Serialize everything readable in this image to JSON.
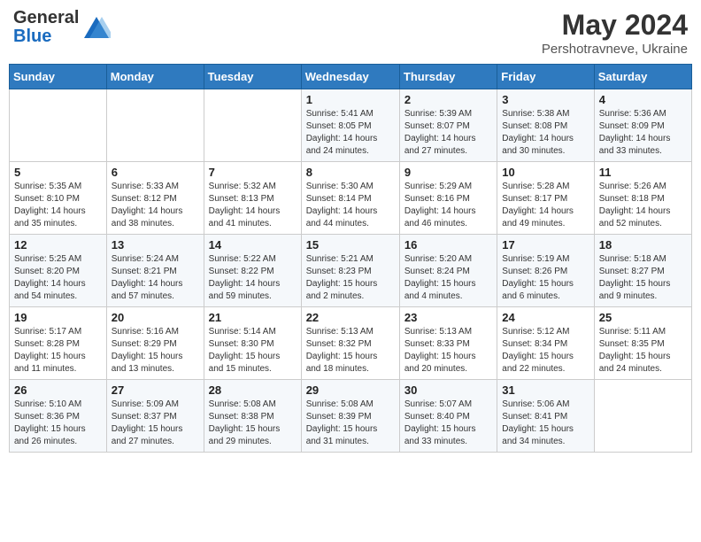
{
  "header": {
    "logo_line1": "General",
    "logo_line2": "Blue",
    "month_year": "May 2024",
    "location": "Pershotravneve, Ukraine"
  },
  "days_of_week": [
    "Sunday",
    "Monday",
    "Tuesday",
    "Wednesday",
    "Thursday",
    "Friday",
    "Saturday"
  ],
  "weeks": [
    [
      {
        "day": "",
        "detail": ""
      },
      {
        "day": "",
        "detail": ""
      },
      {
        "day": "",
        "detail": ""
      },
      {
        "day": "1",
        "detail": "Sunrise: 5:41 AM\nSunset: 8:05 PM\nDaylight: 14 hours\nand 24 minutes."
      },
      {
        "day": "2",
        "detail": "Sunrise: 5:39 AM\nSunset: 8:07 PM\nDaylight: 14 hours\nand 27 minutes."
      },
      {
        "day": "3",
        "detail": "Sunrise: 5:38 AM\nSunset: 8:08 PM\nDaylight: 14 hours\nand 30 minutes."
      },
      {
        "day": "4",
        "detail": "Sunrise: 5:36 AM\nSunset: 8:09 PM\nDaylight: 14 hours\nand 33 minutes."
      }
    ],
    [
      {
        "day": "5",
        "detail": "Sunrise: 5:35 AM\nSunset: 8:10 PM\nDaylight: 14 hours\nand 35 minutes."
      },
      {
        "day": "6",
        "detail": "Sunrise: 5:33 AM\nSunset: 8:12 PM\nDaylight: 14 hours\nand 38 minutes."
      },
      {
        "day": "7",
        "detail": "Sunrise: 5:32 AM\nSunset: 8:13 PM\nDaylight: 14 hours\nand 41 minutes."
      },
      {
        "day": "8",
        "detail": "Sunrise: 5:30 AM\nSunset: 8:14 PM\nDaylight: 14 hours\nand 44 minutes."
      },
      {
        "day": "9",
        "detail": "Sunrise: 5:29 AM\nSunset: 8:16 PM\nDaylight: 14 hours\nand 46 minutes."
      },
      {
        "day": "10",
        "detail": "Sunrise: 5:28 AM\nSunset: 8:17 PM\nDaylight: 14 hours\nand 49 minutes."
      },
      {
        "day": "11",
        "detail": "Sunrise: 5:26 AM\nSunset: 8:18 PM\nDaylight: 14 hours\nand 52 minutes."
      }
    ],
    [
      {
        "day": "12",
        "detail": "Sunrise: 5:25 AM\nSunset: 8:20 PM\nDaylight: 14 hours\nand 54 minutes."
      },
      {
        "day": "13",
        "detail": "Sunrise: 5:24 AM\nSunset: 8:21 PM\nDaylight: 14 hours\nand 57 minutes."
      },
      {
        "day": "14",
        "detail": "Sunrise: 5:22 AM\nSunset: 8:22 PM\nDaylight: 14 hours\nand 59 minutes."
      },
      {
        "day": "15",
        "detail": "Sunrise: 5:21 AM\nSunset: 8:23 PM\nDaylight: 15 hours\nand 2 minutes."
      },
      {
        "day": "16",
        "detail": "Sunrise: 5:20 AM\nSunset: 8:24 PM\nDaylight: 15 hours\nand 4 minutes."
      },
      {
        "day": "17",
        "detail": "Sunrise: 5:19 AM\nSunset: 8:26 PM\nDaylight: 15 hours\nand 6 minutes."
      },
      {
        "day": "18",
        "detail": "Sunrise: 5:18 AM\nSunset: 8:27 PM\nDaylight: 15 hours\nand 9 minutes."
      }
    ],
    [
      {
        "day": "19",
        "detail": "Sunrise: 5:17 AM\nSunset: 8:28 PM\nDaylight: 15 hours\nand 11 minutes."
      },
      {
        "day": "20",
        "detail": "Sunrise: 5:16 AM\nSunset: 8:29 PM\nDaylight: 15 hours\nand 13 minutes."
      },
      {
        "day": "21",
        "detail": "Sunrise: 5:14 AM\nSunset: 8:30 PM\nDaylight: 15 hours\nand 15 minutes."
      },
      {
        "day": "22",
        "detail": "Sunrise: 5:13 AM\nSunset: 8:32 PM\nDaylight: 15 hours\nand 18 minutes."
      },
      {
        "day": "23",
        "detail": "Sunrise: 5:13 AM\nSunset: 8:33 PM\nDaylight: 15 hours\nand 20 minutes."
      },
      {
        "day": "24",
        "detail": "Sunrise: 5:12 AM\nSunset: 8:34 PM\nDaylight: 15 hours\nand 22 minutes."
      },
      {
        "day": "25",
        "detail": "Sunrise: 5:11 AM\nSunset: 8:35 PM\nDaylight: 15 hours\nand 24 minutes."
      }
    ],
    [
      {
        "day": "26",
        "detail": "Sunrise: 5:10 AM\nSunset: 8:36 PM\nDaylight: 15 hours\nand 26 minutes."
      },
      {
        "day": "27",
        "detail": "Sunrise: 5:09 AM\nSunset: 8:37 PM\nDaylight: 15 hours\nand 27 minutes."
      },
      {
        "day": "28",
        "detail": "Sunrise: 5:08 AM\nSunset: 8:38 PM\nDaylight: 15 hours\nand 29 minutes."
      },
      {
        "day": "29",
        "detail": "Sunrise: 5:08 AM\nSunset: 8:39 PM\nDaylight: 15 hours\nand 31 minutes."
      },
      {
        "day": "30",
        "detail": "Sunrise: 5:07 AM\nSunset: 8:40 PM\nDaylight: 15 hours\nand 33 minutes."
      },
      {
        "day": "31",
        "detail": "Sunrise: 5:06 AM\nSunset: 8:41 PM\nDaylight: 15 hours\nand 34 minutes."
      },
      {
        "day": "",
        "detail": ""
      }
    ]
  ]
}
